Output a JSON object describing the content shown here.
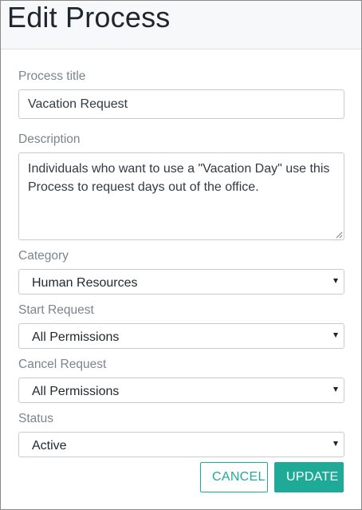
{
  "modal": {
    "title": "Edit Process"
  },
  "form": {
    "process_title": {
      "label": "Process title",
      "value": "Vacation Request"
    },
    "description": {
      "label": "Description",
      "value": "Individuals who want to use a \"Vacation Day\" use this Process to request days out of the office."
    },
    "category": {
      "label": "Category",
      "selected": "Human Resources"
    },
    "start_request": {
      "label": "Start Request",
      "selected": "All Permissions"
    },
    "cancel_request": {
      "label": "Cancel Request",
      "selected": "All Permissions"
    },
    "status": {
      "label": "Status",
      "selected": "Active"
    }
  },
  "actions": {
    "cancel_label": "CANCEL",
    "update_label": "UPDATE"
  },
  "colors": {
    "accent": "#1eaa97",
    "label": "#7d858c",
    "border": "#c7ccd1"
  },
  "icons": {
    "select_caret": "caret-down-icon",
    "resize_grip": "resize-grip-icon"
  }
}
